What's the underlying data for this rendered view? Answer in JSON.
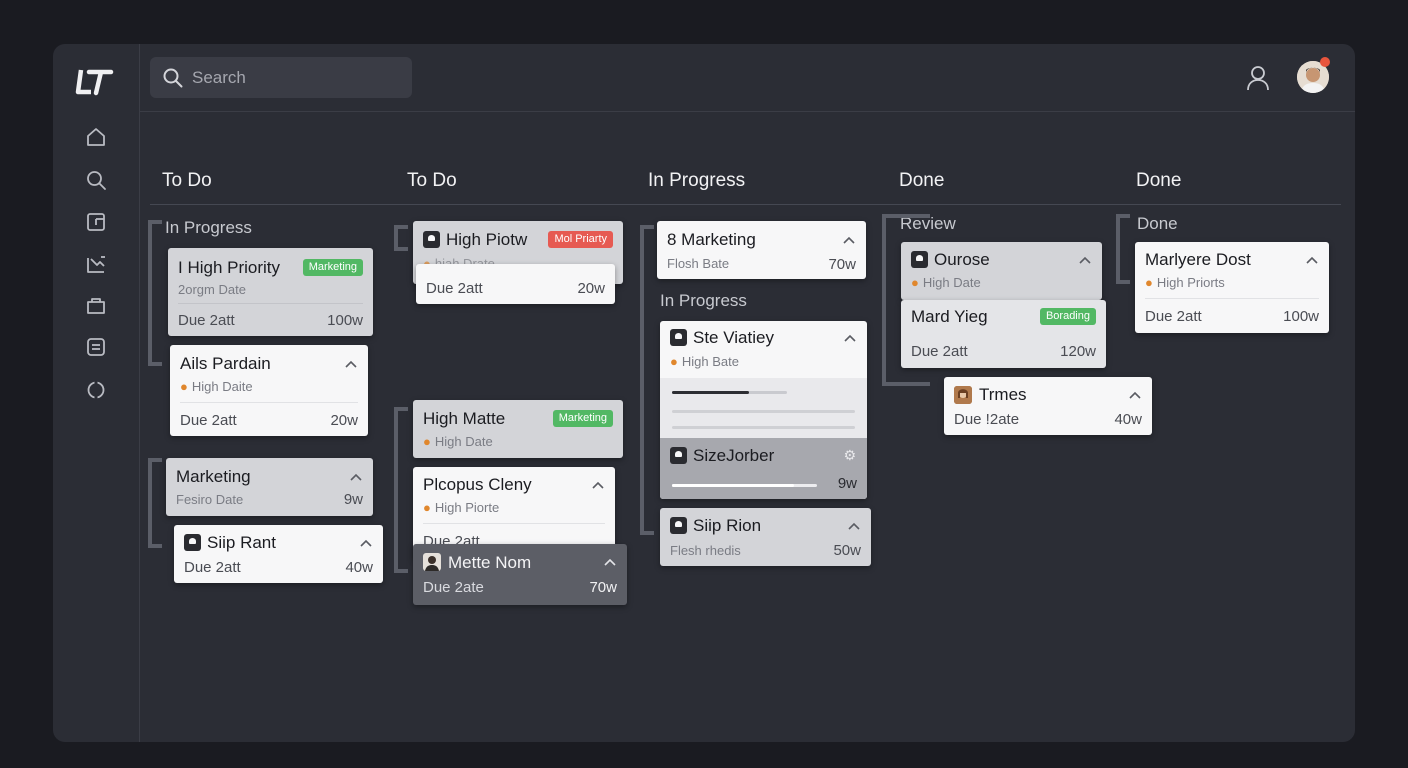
{
  "logo_text": "LT",
  "search": {
    "placeholder": "Search",
    "icon": "search-icon"
  },
  "sidebar": {
    "items": [
      {
        "icon": "home-icon"
      },
      {
        "icon": "search-icon"
      },
      {
        "icon": "board-icon"
      },
      {
        "icon": "chart-icon"
      },
      {
        "icon": "folder-icon"
      },
      {
        "icon": "inbox-icon"
      },
      {
        "icon": "settings-icon"
      }
    ]
  },
  "header": {
    "user_icon": "user-icon",
    "avatar": "avatar"
  },
  "columns": [
    {
      "title": "To Do"
    },
    {
      "title": "To Do"
    },
    {
      "title": "In Progress"
    },
    {
      "title": "Done"
    },
    {
      "title": "Done"
    }
  ],
  "groups": {
    "g1": "In Progress",
    "g2": "In Progress",
    "g3": "Review",
    "g4": "Done"
  },
  "cards": {
    "c1": {
      "title": "I High Priority",
      "badge": "Marketing",
      "sub": "2orgm Date",
      "due": "Due 2att",
      "num": "100w"
    },
    "c2": {
      "title": "Ails Pardain",
      "sub": "High Daite",
      "due": "Due 2att",
      "num": "20w"
    },
    "c3": {
      "title": "Marketing",
      "sub": "Fesiro Date",
      "num": "9w"
    },
    "c4": {
      "title": "Siip Rant",
      "due": "Due 2att",
      "num": "40w"
    },
    "c5": {
      "title": "High Piotw",
      "badge": "Mol Priarty",
      "sub": "hiah Drate"
    },
    "c6": {
      "due": "Due 2att",
      "num": "20w"
    },
    "c7": {
      "title": "High Matte",
      "badge": "Marketing",
      "sub": "High Date"
    },
    "c8": {
      "title": "Plcopus Cleny",
      "sub": "High Piorte",
      "due": "Due 2att"
    },
    "c9": {
      "title": "Mette Nom",
      "due": "Due 2ate",
      "num": "70w"
    },
    "c10": {
      "title": "8 Marketing",
      "sub": "Flosh Bate",
      "num": "70w"
    },
    "c11": {
      "title": "Ste Viatiey",
      "sub": "High Bate",
      "title2": "SizeJorber",
      "num": "9w"
    },
    "c12": {
      "title": "Siip Rion",
      "sub": "Flesh rhedis",
      "num": "50w"
    },
    "c13": {
      "title": "Ourose",
      "sub": "High Date"
    },
    "c14": {
      "title": "Mard Yieg",
      "badge": "Borading",
      "due": "Due 2att",
      "num": "120w"
    },
    "c15": {
      "title": "Trmes",
      "due": "Due !2ate",
      "num": "40w"
    },
    "c16": {
      "title": "Marlyere Dost",
      "sub": "High Priorts",
      "due": "Due 2att",
      "num": "100w"
    }
  },
  "colors": {
    "accent_green": "#52b864",
    "accent_red": "#e65a52",
    "flame": "#e0872d",
    "background": "#2b2d35"
  }
}
